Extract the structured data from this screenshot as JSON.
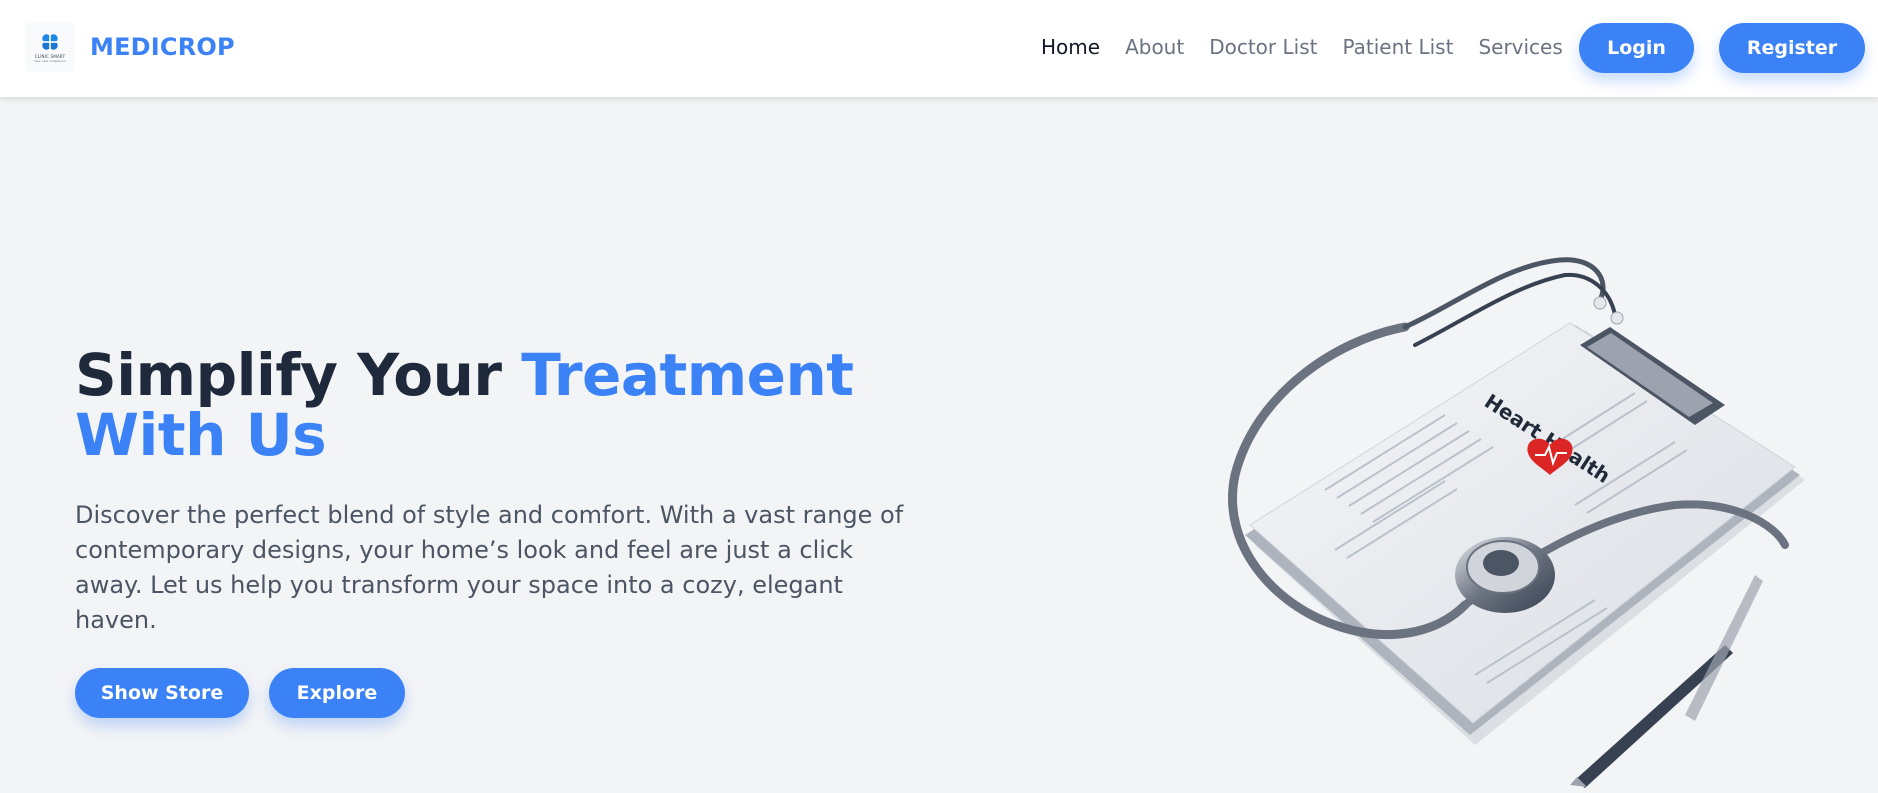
{
  "brand": {
    "name": "MEDICROP",
    "logo_text": "CLINIC SMART",
    "logo_subtext": "Your care companion",
    "logo_icon": "clover-medical-icon"
  },
  "nav": {
    "links": [
      "Home",
      "About",
      "Doctor List",
      "Patient List",
      "Services"
    ],
    "active": "Home",
    "login_label": "Login",
    "register_label": "Register"
  },
  "hero": {
    "title_part1": "Simplify Your ",
    "title_accent": "Treatment With Us",
    "description": "Discover the perfect blend of style and comfort. With a vast range of contemporary designs, your home’s look and feel are just a click away. Let us help you transform your space into a cozy, elegant haven.",
    "primary_button": "Show Store",
    "secondary_button": "Explore",
    "illustration": {
      "icon": "stethoscope-clipboard-illustration",
      "document_title": "Heart Health"
    }
  },
  "colors": {
    "accent": "#3b82f6",
    "heading": "#1e293b",
    "body_text": "#4b5563",
    "background": "#f3f4f6"
  }
}
